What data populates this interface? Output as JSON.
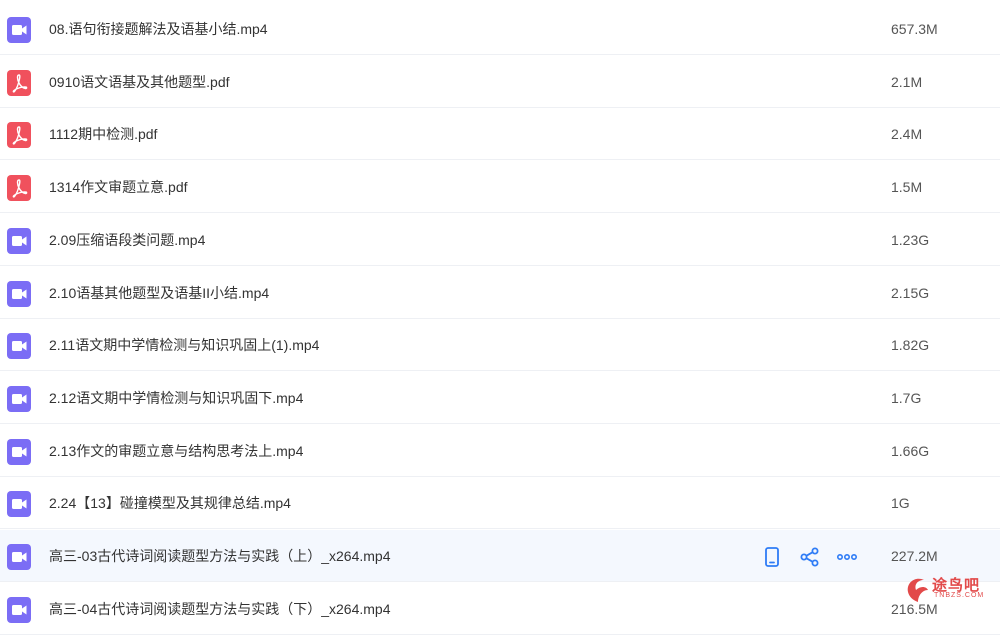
{
  "files": [
    {
      "name": "08.语句衔接题解法及语基小结.mp4",
      "size": "657.3M",
      "type": "video",
      "icon": "video-file-icon"
    },
    {
      "name": "0910语文语基及其他题型.pdf",
      "size": "2.1M",
      "type": "pdf",
      "icon": "pdf-file-icon"
    },
    {
      "name": "1112期中检测.pdf",
      "size": "2.4M",
      "type": "pdf",
      "icon": "pdf-file-icon"
    },
    {
      "name": "1314作文审题立意.pdf",
      "size": "1.5M",
      "type": "pdf",
      "icon": "pdf-file-icon"
    },
    {
      "name": "2.09压缩语段类问题.mp4",
      "size": "1.23G",
      "type": "video",
      "icon": "video-file-icon"
    },
    {
      "name": "2.10语基其他题型及语基II小结.mp4",
      "size": "2.15G",
      "type": "video",
      "icon": "video-file-icon"
    },
    {
      "name": "2.11语文期中学情检测与知识巩固上(1).mp4",
      "size": "1.82G",
      "type": "video",
      "icon": "video-file-icon"
    },
    {
      "name": "2.12语文期中学情检测与知识巩固下.mp4",
      "size": "1.7G",
      "type": "video",
      "icon": "video-file-icon"
    },
    {
      "name": "2.13作文的审题立意与结构思考法上.mp4",
      "size": "1.66G",
      "type": "video",
      "icon": "video-file-icon"
    },
    {
      "name": "2.24【13】碰撞模型及其规律总结.mp4",
      "size": "1G",
      "type": "video",
      "icon": "video-file-icon"
    },
    {
      "name": "高三-03古代诗词阅读题型方法与实践（上）_x264.mp4",
      "size": "227.2M",
      "type": "video",
      "icon": "video-file-icon",
      "hover": true
    },
    {
      "name": "高三-04古代诗词阅读题型方法与实践（下）_x264.mp4",
      "size": "216.5M",
      "type": "video",
      "icon": "video-file-icon"
    }
  ],
  "row_actions": [
    {
      "name": "phone-icon",
      "label": "send-to-phone"
    },
    {
      "name": "share-icon",
      "label": "share"
    },
    {
      "name": "more-icon",
      "label": "more"
    }
  ],
  "colors": {
    "video_icon": "#7b6df5",
    "pdf_icon": "#f0515d",
    "accent": "#2e7cf6",
    "hover_row": "#f4f8fe"
  },
  "watermark": {
    "text": "途鸟吧",
    "sub": "TNBZS.COM"
  }
}
